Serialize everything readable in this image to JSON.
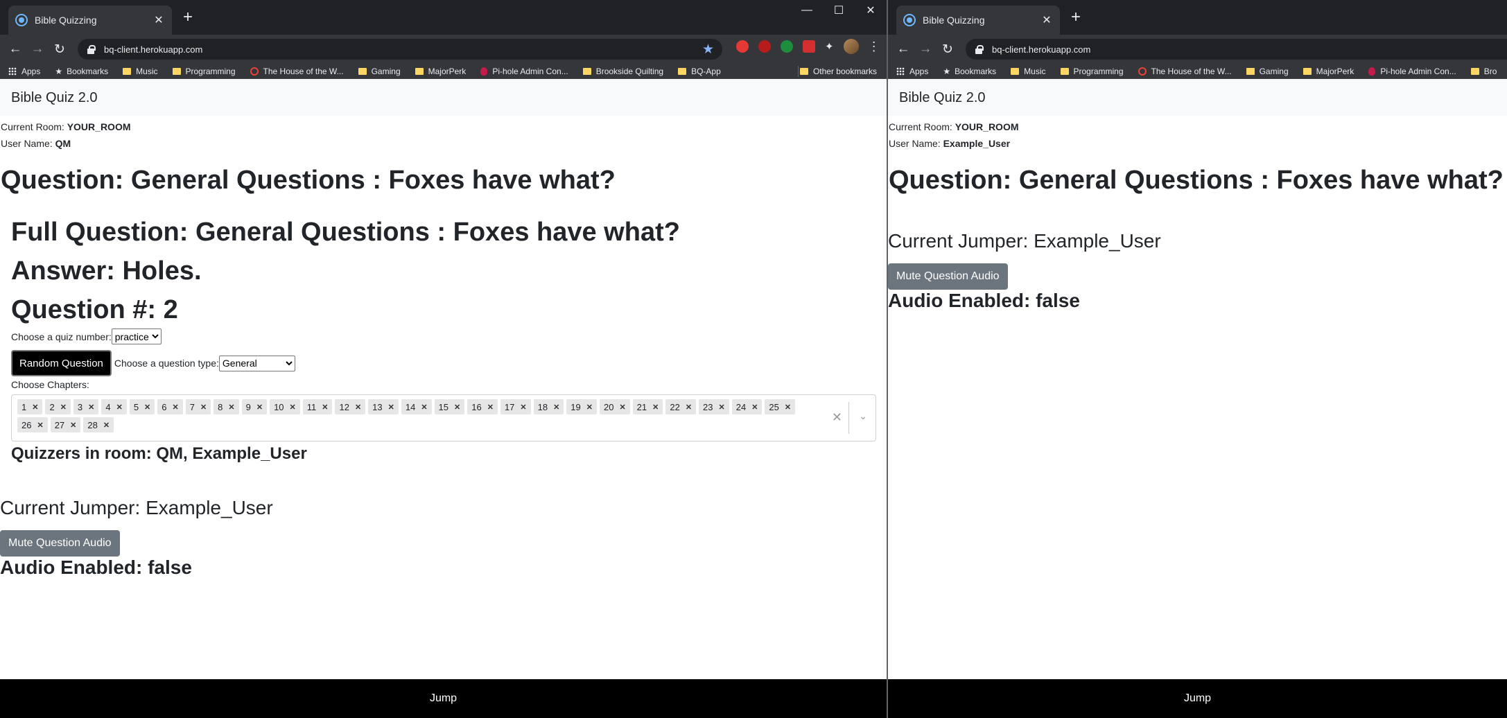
{
  "browser": {
    "tab_title": "Bible Quizzing",
    "url": "bq-client.herokuapp.com",
    "bookmarks": [
      "Apps",
      "Bookmarks",
      "Music",
      "Programming",
      "The House of the W...",
      "Gaming",
      "MajorPerk",
      "Pi-hole Admin Con...",
      "Brookside Quilting",
      "BQ-App"
    ],
    "other_bookmarks": "Other bookmarks",
    "right_bookmarks_last": "Bro"
  },
  "app": {
    "brand": "Bible Quiz 2.0",
    "current_room_label": "Current Room:",
    "room": "YOUR_ROOM",
    "user_name_label": "User Name:",
    "jump_label": "Jump",
    "mute_label": "Mute Question Audio",
    "audio_enabled": "Audio Enabled: false",
    "question_heading": "Question: General Questions : Foxes have what?",
    "current_jumper": "Current Jumper: Example_User"
  },
  "left": {
    "user_name": "QM",
    "full_question": "Full Question: General Questions : Foxes have what?",
    "answer": "Answer: Holes.",
    "question_number": "Question #: 2",
    "quiz_number_label": "Choose a quiz number:",
    "quiz_number_value": "practice",
    "random_question_label": "Random Question",
    "question_type_label": "Choose a question type:",
    "question_type_value": "General",
    "chapters_label": "Choose Chapters:",
    "chapters": [
      "1",
      "2",
      "3",
      "4",
      "5",
      "6",
      "7",
      "8",
      "9",
      "10",
      "11",
      "12",
      "13",
      "14",
      "15",
      "16",
      "17",
      "18",
      "19",
      "20",
      "21",
      "22",
      "23",
      "24",
      "25",
      "26",
      "27",
      "28"
    ],
    "quizzers": "Quizzers in room: QM, Example_User"
  },
  "right": {
    "user_name": "Example_User"
  }
}
